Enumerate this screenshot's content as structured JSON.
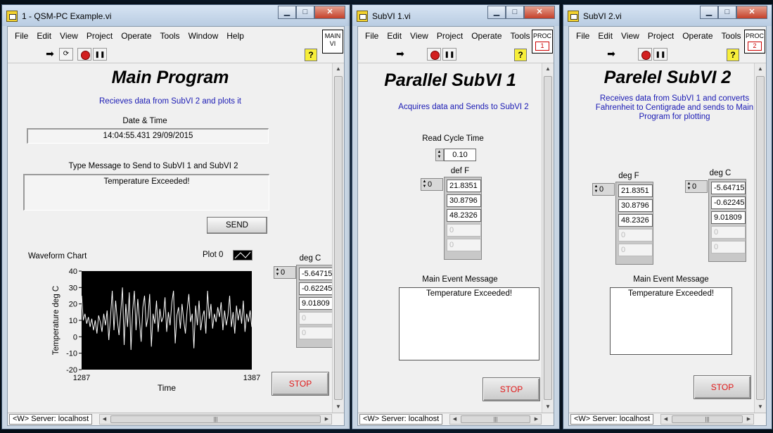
{
  "windows": {
    "main": {
      "title": "1 - QSM-PC Example.vi",
      "menu": [
        "File",
        "Edit",
        "View",
        "Project",
        "Operate",
        "Tools",
        "Window",
        "Help"
      ],
      "connector_label": "MAIN VI",
      "heading": "Main Program",
      "description": "Recieves data from SubVI 2 and plots it",
      "datetime_label": "Date & Time",
      "datetime_value": "14:04:55.431 29/09/2015",
      "message_label": "Type Message to Send to SubVI 1 and SubVI 2",
      "message_value": "Temperature Exceeded!",
      "send_label": "SEND",
      "chart_label": "Waveform Chart",
      "plot_legend": "Plot 0",
      "array_label": "deg C",
      "array_index": "0",
      "array_values": [
        "-5.64715",
        "-0.62245",
        "9.01809",
        "0",
        "0"
      ],
      "stop_label": "STOP",
      "status_server": "<W> Server: localhost"
    },
    "sub1": {
      "title": "SubVI 1.vi",
      "menu": [
        "File",
        "Edit",
        "View",
        "Project",
        "Operate",
        "Tools"
      ],
      "connector_label": "PROC",
      "connector_num": "1",
      "heading": "Parallel SubVI 1",
      "description": "Acquires data and Sends to SubVI 2",
      "cycle_label": "Read Cycle Time",
      "cycle_value": "0.10",
      "array_label": "def F",
      "array_index": "0",
      "array_values": [
        "21.8351",
        "30.8796",
        "48.2326",
        "0",
        "0"
      ],
      "event_label": "Main Event Message",
      "event_value": "Temperature Exceeded!",
      "stop_label": "STOP",
      "status_server": "<W> Server: localhost"
    },
    "sub2": {
      "title": "SubVI 2.vi",
      "menu": [
        "File",
        "Edit",
        "View",
        "Project",
        "Operate",
        "Tools"
      ],
      "connector_label": "PROC",
      "connector_num": "2",
      "heading": "Parelel SubVI 2",
      "description": "Receives data from SubVI 1 and converts Fahrenheit to Centigrade and sends to Main Program for plotting",
      "arrayF_label": "deg F",
      "arrayF_index": "0",
      "arrayF_values": [
        "21.8351",
        "30.8796",
        "48.2326",
        "0",
        "0"
      ],
      "arrayC_label": "deg C",
      "arrayC_index": "0",
      "arrayC_values": [
        "-5.64715",
        "-0.62245",
        "9.01809",
        "0",
        "0"
      ],
      "event_label": "Main Event Message",
      "event_value": "Temperature Exceeded!",
      "stop_label": "STOP",
      "status_server": "<W> Server: localhost"
    }
  },
  "colors": {
    "stop_text": "#e01818",
    "description_text": "#1a1ab4",
    "plot_line": "#ffffff",
    "chart_bg": "#000000"
  },
  "chart_data": {
    "type": "line",
    "title": "Waveform Chart",
    "xlabel": "Time",
    "ylabel": "Temperature deg C",
    "xlim": [
      1287,
      1387
    ],
    "ylim": [
      -20,
      40
    ],
    "x_ticks": [
      "1287",
      "1387"
    ],
    "y_ticks": [
      "40",
      "30",
      "20",
      "10",
      "0",
      "-10",
      "-20"
    ],
    "series": [
      {
        "name": "Plot 0",
        "values": [
          25,
          10,
          14,
          8,
          12,
          6,
          11,
          4,
          10,
          2,
          13,
          9,
          3,
          14,
          7,
          16,
          -2,
          12,
          28,
          4,
          22,
          10,
          1,
          15,
          30,
          -5,
          20,
          6,
          27,
          -8,
          16,
          28,
          4,
          23,
          10,
          -3,
          18,
          25,
          6,
          12,
          26,
          -6,
          14,
          8,
          22,
          3,
          17,
          9,
          12,
          24,
          3,
          15,
          7,
          21,
          28,
          -4,
          13,
          18,
          5,
          20,
          10,
          2,
          16,
          26,
          9,
          14,
          -7,
          19,
          7,
          22,
          4,
          12,
          16,
          2,
          28,
          11,
          20,
          5,
          14,
          9,
          18,
          12,
          21,
          4,
          16,
          7,
          13,
          25,
          6,
          15,
          2,
          19,
          10,
          17,
          8,
          22,
          3,
          14,
          9,
          16,
          6
        ]
      }
    ]
  }
}
